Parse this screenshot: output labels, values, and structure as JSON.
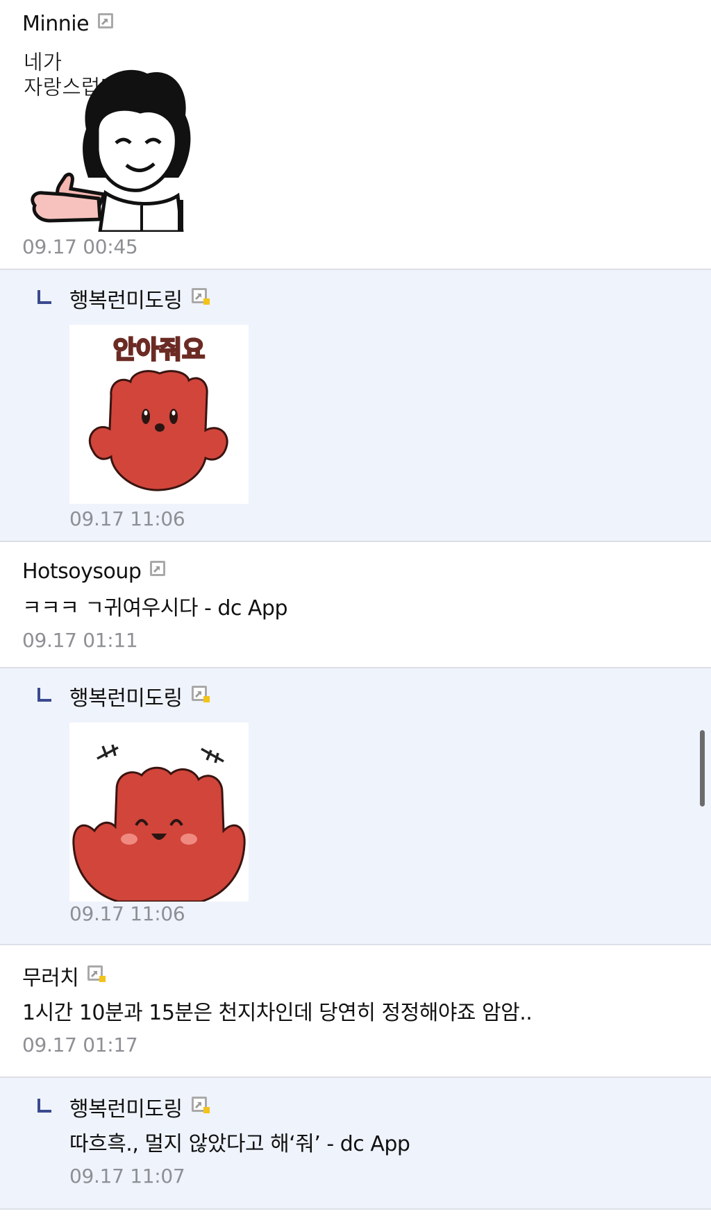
{
  "comments": [
    {
      "type": "comment",
      "nickname": "Minnie",
      "icon": "gallery-icon-gray",
      "sticker": {
        "icon": "pixel-grandma-thumbs-sticker",
        "caption": "네가\n자랑스럽단다"
      },
      "timestamp": "09.17 00:45"
    },
    {
      "type": "reply",
      "nickname": "행복런미도링",
      "icon": "gallery-icon-gold",
      "sticker": {
        "icon": "red-glove-hug-sticker",
        "caption": "안아줘요"
      },
      "timestamp": "09.17 11:06"
    },
    {
      "type": "comment",
      "nickname": "Hotsoysoup",
      "icon": "gallery-icon-gray",
      "text": "ㅋㅋㅋ ㄱ귀여우시다 - dc App",
      "timestamp": "09.17 01:11"
    },
    {
      "type": "reply",
      "nickname": "행복런미도링",
      "icon": "gallery-icon-gold",
      "sticker": {
        "icon": "red-glove-laughing-sticker",
        "caption": ""
      },
      "timestamp": "09.17 11:06"
    },
    {
      "type": "comment",
      "nickname": "무러치",
      "icon": "gallery-icon-gold",
      "text": "1시간 10분과 15분은 천지차인데 당연히 정정해야죠 암암..",
      "timestamp": "09.17 01:17"
    },
    {
      "type": "reply",
      "nickname": "행복런미도링",
      "icon": "gallery-icon-gold",
      "text": "따흐흑., 멀지 않았다고 해‘줘’ - dc App",
      "timestamp": "09.17 11:07"
    }
  ],
  "colors": {
    "reply_background": "#eff3fc",
    "divider": "#dcdfe7",
    "reply_arrow": "#3b4a8f",
    "timestamp": "#8d8f94",
    "sticker_red": "#d1453b"
  }
}
